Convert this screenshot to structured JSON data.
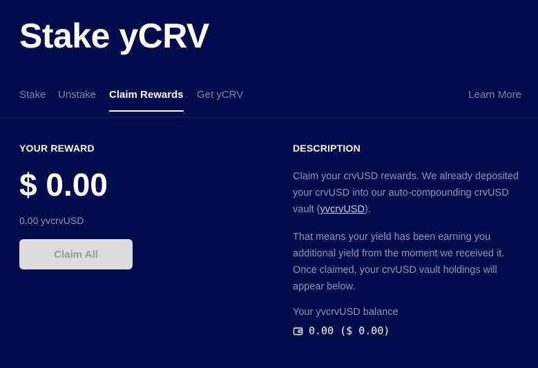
{
  "header": {
    "title": "Stake yCRV"
  },
  "tabs": [
    {
      "label": "Stake",
      "active": false
    },
    {
      "label": "Unstake",
      "active": false
    },
    {
      "label": "Claim Rewards",
      "active": true
    },
    {
      "label": "Get yCRV",
      "active": false
    }
  ],
  "nav": {
    "learn_more": "Learn More"
  },
  "reward": {
    "heading": "YOUR REWARD",
    "amount": "$ 0.00",
    "token_amount": "0.00 yvcrvUSD",
    "claim_button": "Claim All",
    "claim_button_disabled": true
  },
  "description": {
    "heading": "DESCRIPTION",
    "paragraph1_before": "Claim your crvUSD rewards. We already deposited your crvUSD into our auto-compounding crvUSD vault (",
    "paragraph1_link": "yvcrvUSD",
    "paragraph1_after": ").",
    "paragraph2": "That means your yield has been earning you additional yield from the moment we received it. Once claimed, your crvUSD vault holdings will appear below.",
    "balance_label": "Your yvcrvUSD balance",
    "balance_value": "0.00 ($ 0.00)",
    "balance_icon": "wallet-icon"
  },
  "colors": {
    "background": "#010a4a",
    "text_primary": "#ffffff",
    "text_muted": "#8e93b6",
    "button_disabled_bg": "#dcdcdc"
  }
}
